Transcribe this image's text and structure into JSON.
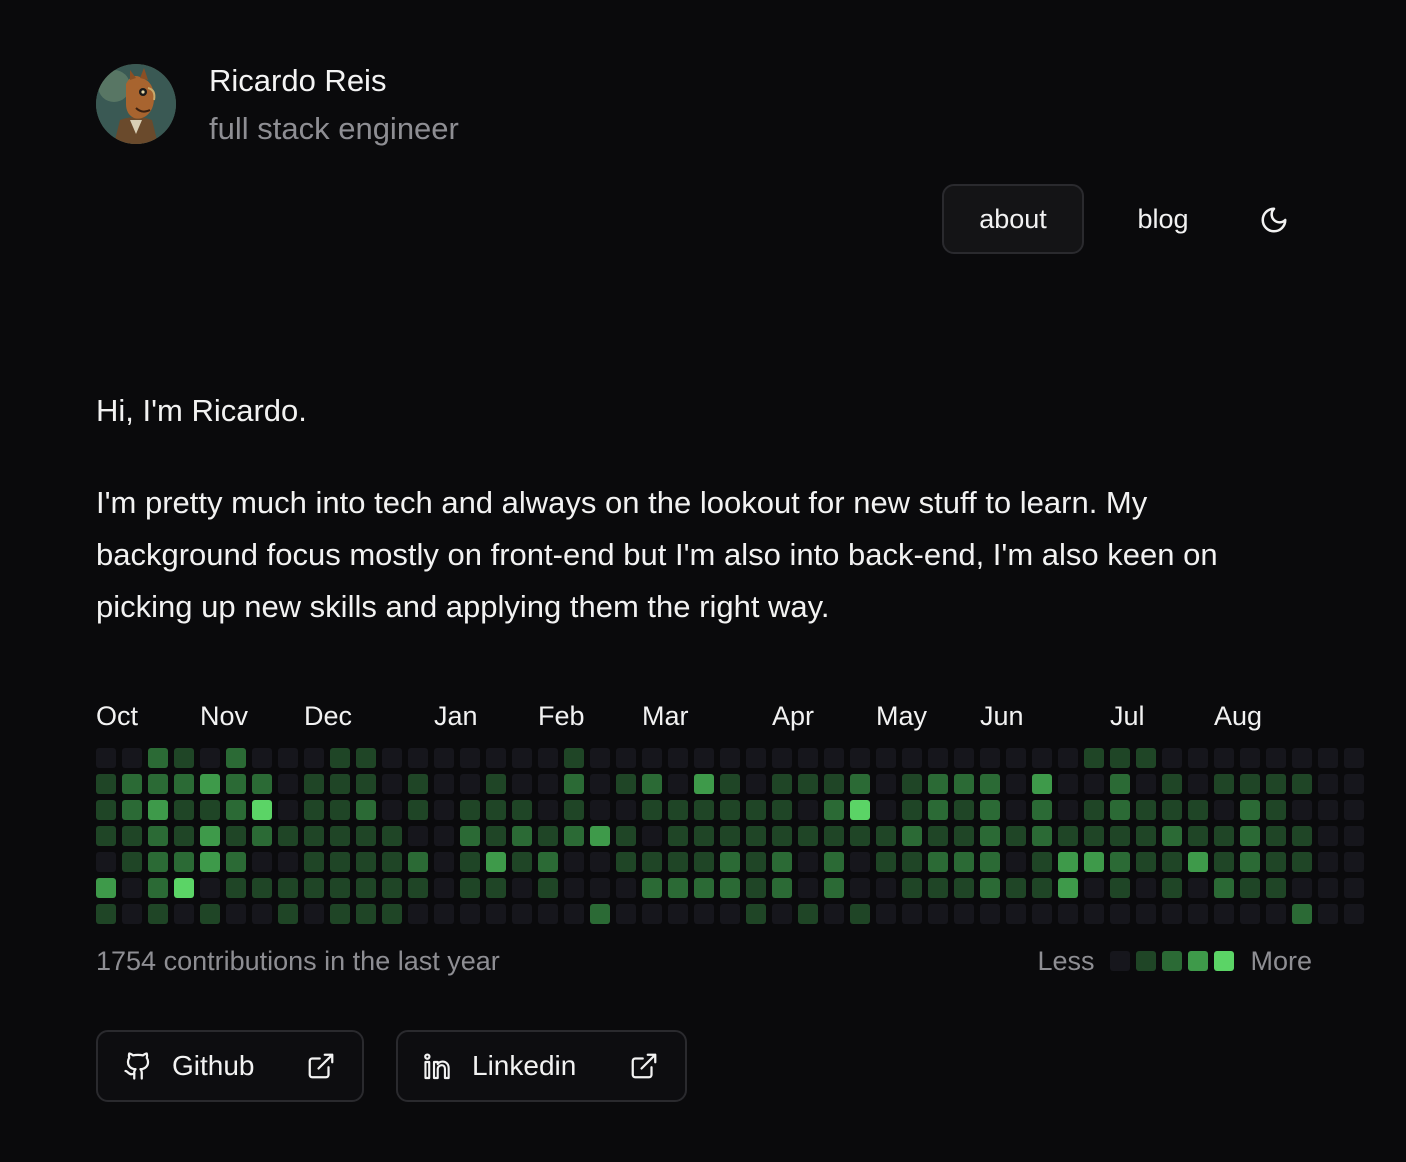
{
  "profile": {
    "name": "Ricardo Reis",
    "role": "full stack engineer"
  },
  "nav": {
    "about_label": "about",
    "blog_label": "blog",
    "theme_icon": "moon-icon"
  },
  "intro": {
    "greeting": "Hi, I'm Ricardo.",
    "bio": "I'm pretty much into tech and always on the lookout for new stuff to learn. My background focus mostly on front-end but I'm also into back-end, I'm also keen on picking up new skills and applying them the right way."
  },
  "contributions": {
    "months": [
      "Oct",
      "Nov",
      "Dec",
      "Jan",
      "Feb",
      "Mar",
      "Apr",
      "May",
      "Jun",
      "Jul",
      "Aug"
    ],
    "month_start_week": [
      0,
      4,
      8,
      13,
      17,
      21,
      26,
      30,
      34,
      39,
      43
    ],
    "summary": "1754 contributions in the last year",
    "legend_less": "Less",
    "legend_more": "More",
    "colors": [
      "#16161c",
      "#1f4526",
      "#2b6a35",
      "#3e9a4a",
      "#5bd466"
    ],
    "levels": [
      "0021020001100000001000000000000000000011100000000",
      "1222322011101001002012031011120122203002010111100",
      "1231124011201011101001111110240121202012111021000",
      "1121312111110021212310111111111211212111121121100",
      "0122320011112013120011112120201122201332113121100",
      "3024011111111011010002222120200111211301010211000",
      "1010100101110000000200000101010000000000000000200"
    ]
  },
  "links": {
    "github_label": "Github",
    "linkedin_label": "Linkedin",
    "github_icon": "github-icon",
    "linkedin_icon": "linkedin-icon",
    "external_icon": "external-link-icon"
  }
}
